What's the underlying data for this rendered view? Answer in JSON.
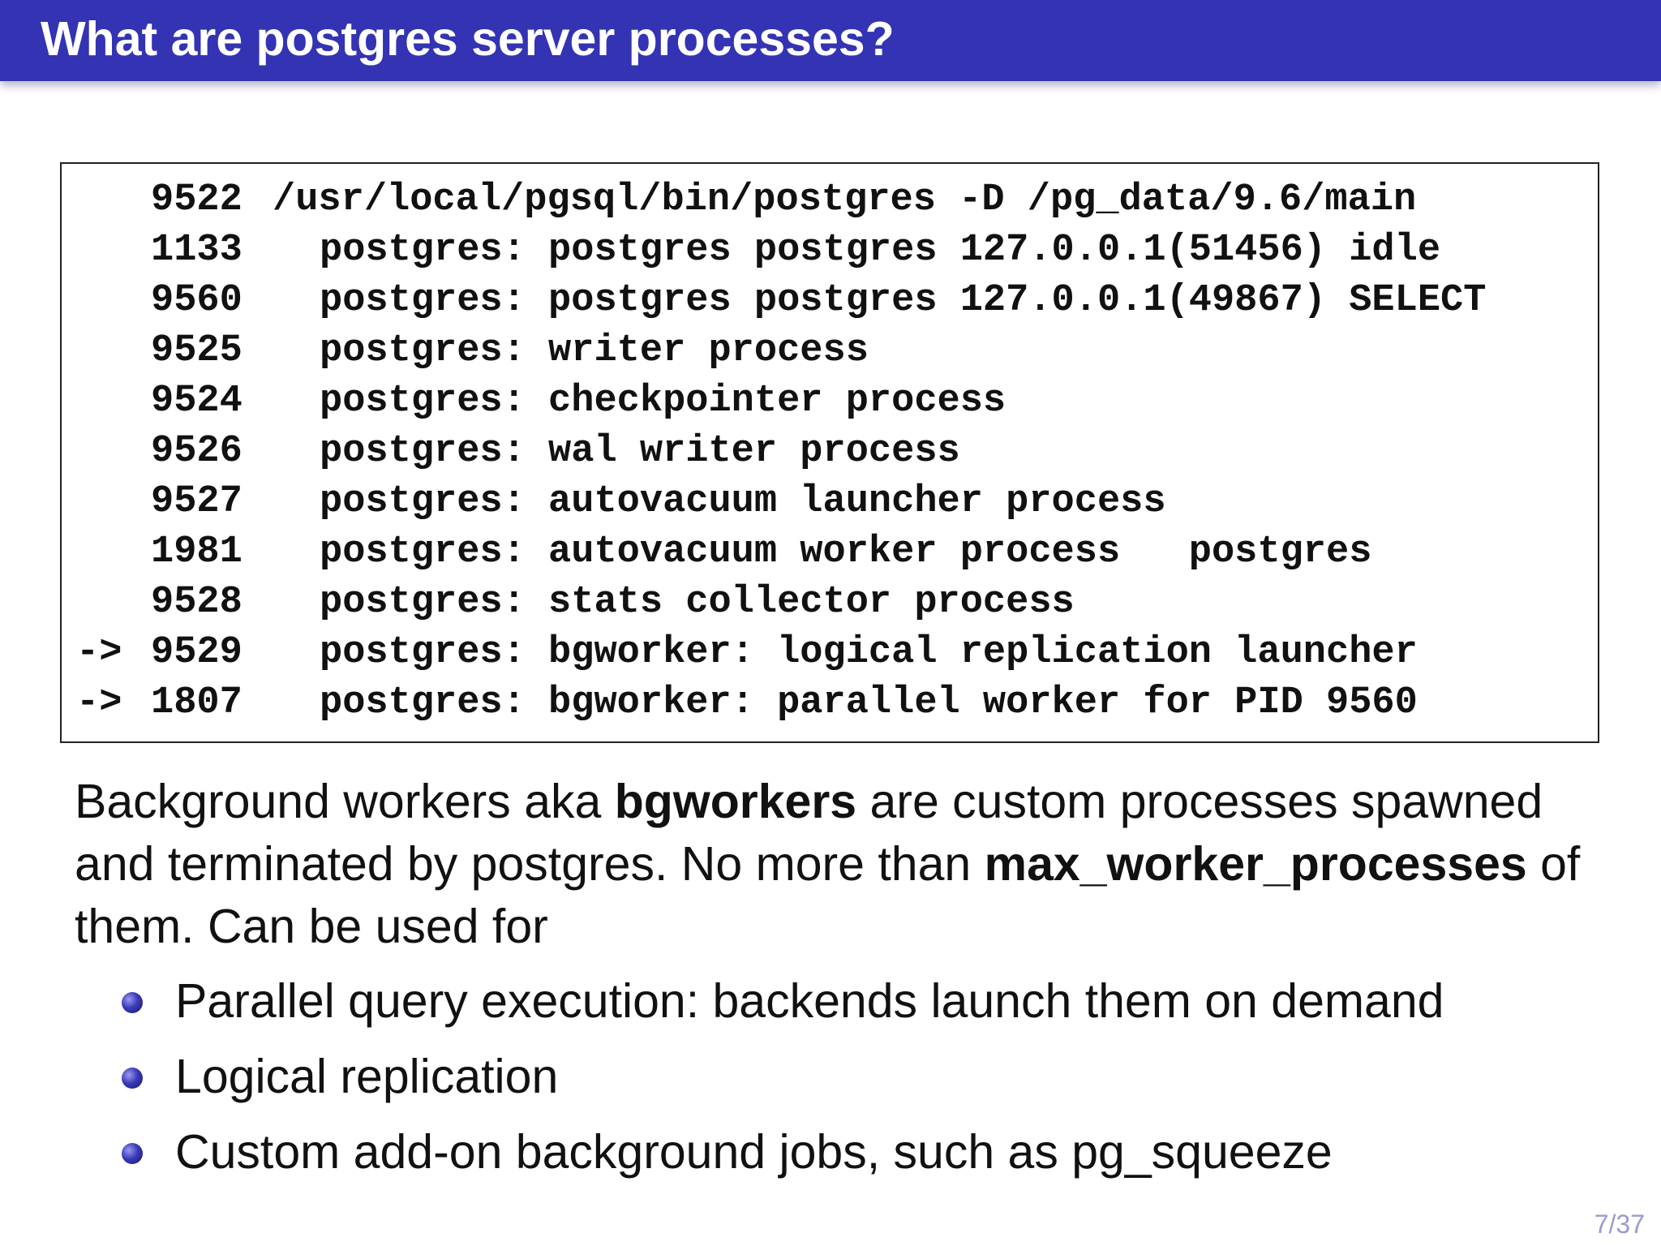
{
  "slide": {
    "title": "What are postgres server processes?",
    "page_number": "7/37"
  },
  "colors": {
    "title_bar": "#3333b3",
    "title_text": "#ffffff",
    "bullet": "#3a3ab8",
    "page_number": "#9a9ad0"
  },
  "processes": [
    {
      "marker": "",
      "pid": "9522",
      "command": "/usr/local/pgsql/bin/postgres -D /pg_data/9.6/main"
    },
    {
      "marker": "",
      "pid": "1133",
      "command": "postgres: postgres postgres 127.0.0.1(51456) idle"
    },
    {
      "marker": "",
      "pid": "9560",
      "command": "postgres: postgres postgres 127.0.0.1(49867) SELECT"
    },
    {
      "marker": "",
      "pid": "9525",
      "command": "postgres: writer process"
    },
    {
      "marker": "",
      "pid": "9524",
      "command": "postgres: checkpointer process"
    },
    {
      "marker": "",
      "pid": "9526",
      "command": "postgres: wal writer process"
    },
    {
      "marker": "",
      "pid": "9527",
      "command": "postgres: autovacuum launcher process"
    },
    {
      "marker": "",
      "pid": "1981",
      "command": "postgres: autovacuum worker process   postgres"
    },
    {
      "marker": "",
      "pid": "9528",
      "command": "postgres: stats collector process"
    },
    {
      "marker": "->",
      "pid": "9529",
      "command": "postgres: bgworker: logical replication launcher"
    },
    {
      "marker": "->",
      "pid": "1807",
      "command": "postgres: bgworker: parallel worker for PID 9560"
    }
  ],
  "description": {
    "part1": "Background workers aka ",
    "bold1": "bgworkers",
    "part2": " are custom processes spawned and terminated by postgres. No more than ",
    "bold2": "max_worker_processes",
    "part3": " of them. Can be used for"
  },
  "bullets": [
    "Parallel query execution: backends launch them on demand",
    "Logical replication",
    "Custom add-on background jobs, such as pg_squeeze"
  ]
}
